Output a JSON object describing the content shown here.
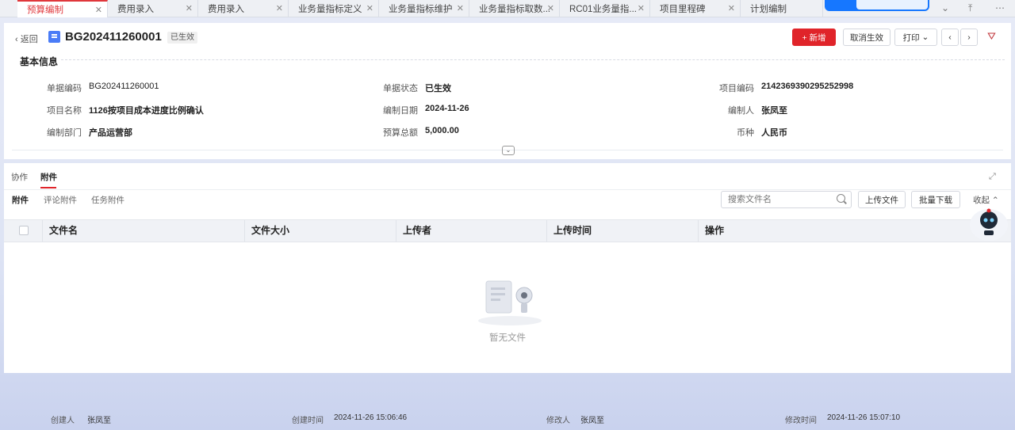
{
  "tabs": [
    {
      "label": "预算编制",
      "active": true
    },
    {
      "label": "费用录入"
    },
    {
      "label": "费用录入"
    },
    {
      "label": "业务量指标定义"
    },
    {
      "label": "业务量指标维护"
    },
    {
      "label": "业务量指标取数..."
    },
    {
      "label": "RC01业务量指..."
    },
    {
      "label": "项目里程碑"
    },
    {
      "label": "计划编制"
    }
  ],
  "header": {
    "back_label": "返回",
    "bill_no": "BG202411260001",
    "status": "已生效",
    "buttons": {
      "new": "+ 新增",
      "cancel_effect": "取消生效",
      "print": "打印"
    }
  },
  "basic_info": {
    "title": "基本信息",
    "fields": [
      {
        "label": "单据编码",
        "value": "BG202411260001"
      },
      {
        "label": "单据状态",
        "value": "已生效"
      },
      {
        "label": "项目编码",
        "value": "2142369390295252998"
      },
      {
        "label": "项目名称",
        "value": "1126按项目成本进度比例确认"
      },
      {
        "label": "编制日期",
        "value": "2024-11-26"
      },
      {
        "label": "编制人",
        "value": "张凤至"
      },
      {
        "label": "编制部门",
        "value": "产品运营部"
      },
      {
        "label": "预算总额",
        "value": "5,000.00"
      },
      {
        "label": "币种",
        "value": "人民币"
      }
    ]
  },
  "attachments": {
    "tabs": [
      "协作",
      "附件"
    ],
    "subtabs": [
      "附件",
      "评论附件",
      "任务附件"
    ],
    "search_placeholder": "搜索文件名",
    "upload": "上传文件",
    "batch_download": "批量下载",
    "collapse": "收起",
    "columns": [
      "文件名",
      "文件大小",
      "上传者",
      "上传时间",
      "操作"
    ],
    "empty_text": "暂无文件"
  },
  "footer": {
    "creator_label": "创建人",
    "creator": "张凤至",
    "created_label": "创建时间",
    "created": "2024-11-26 15:06:46",
    "modifier_label": "修改人",
    "modifier": "张凤至",
    "modified_label": "修改时间",
    "modified": "2024-11-26 15:07:10"
  },
  "colors": {
    "accent": "#e0242a",
    "doc_icon": "#4a7cf7"
  }
}
